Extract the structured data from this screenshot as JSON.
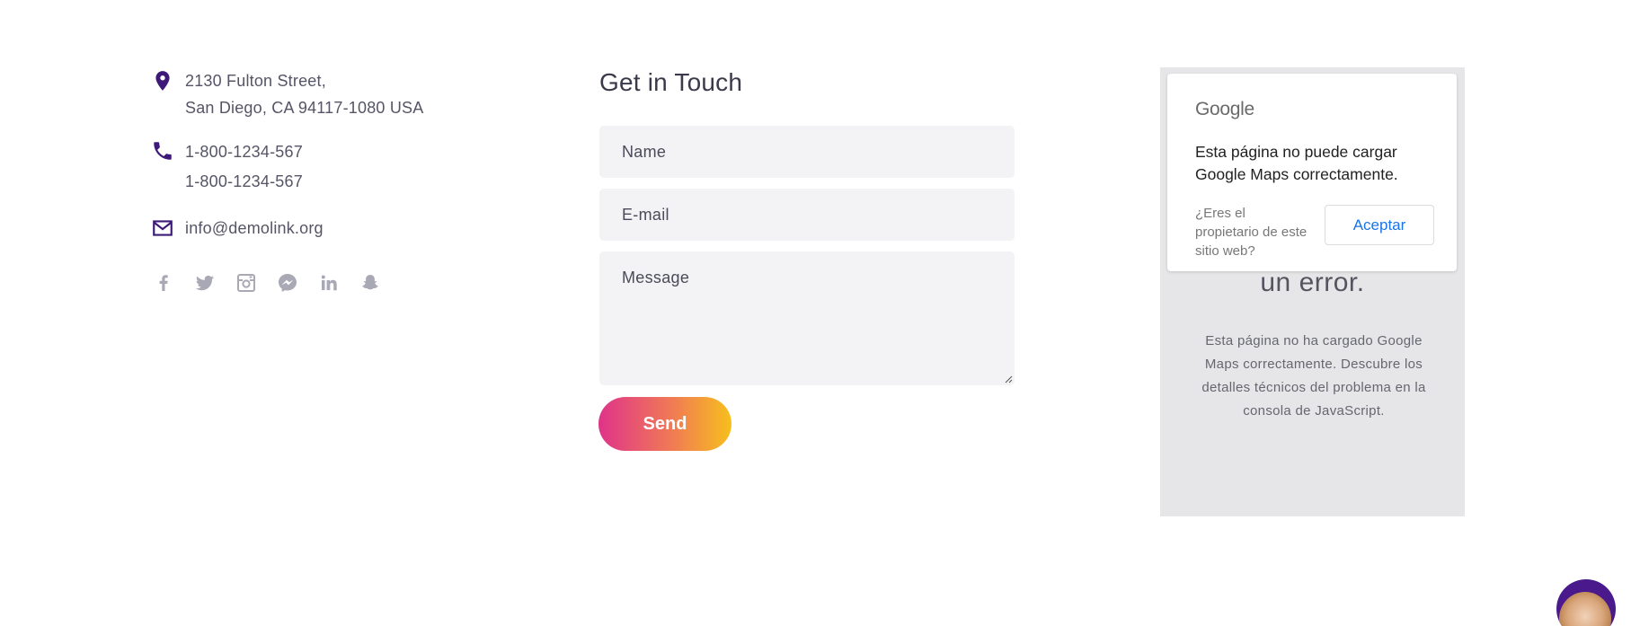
{
  "contact": {
    "address_line1": "2130 Fulton Street,",
    "address_line2": "San Diego, CA 94117-1080 USA",
    "phone1": "1-800-1234-567",
    "phone2": "1-800-1234-567",
    "email": "info@demolink.org",
    "icons": [
      "location-pin-icon",
      "phone-icon",
      "mail-icon"
    ],
    "icon_color": "#3d1a78"
  },
  "socials": [
    "facebook-icon",
    "twitter-icon",
    "instagram-icon",
    "messenger-icon",
    "linkedin-icon",
    "snapchat-icon"
  ],
  "form": {
    "title": "Get in Touch",
    "name_placeholder": "Name",
    "email_placeholder": "E-mail",
    "message_placeholder": "Message",
    "send_label": "Send",
    "send_gradient": [
      "#e0338a",
      "#f7bf1d"
    ]
  },
  "map": {
    "logo": "Google",
    "card_message": "Esta página no puede cargar Google Maps correctamente.",
    "owner_question": "¿Eres el propietario de este sitio web?",
    "accept_label": "Aceptar",
    "error_title": "un error.",
    "error_text": "Esta página no ha cargado Google Maps correctamente. Descubre los detalles técnicos del problema en la consola de JavaScript."
  }
}
